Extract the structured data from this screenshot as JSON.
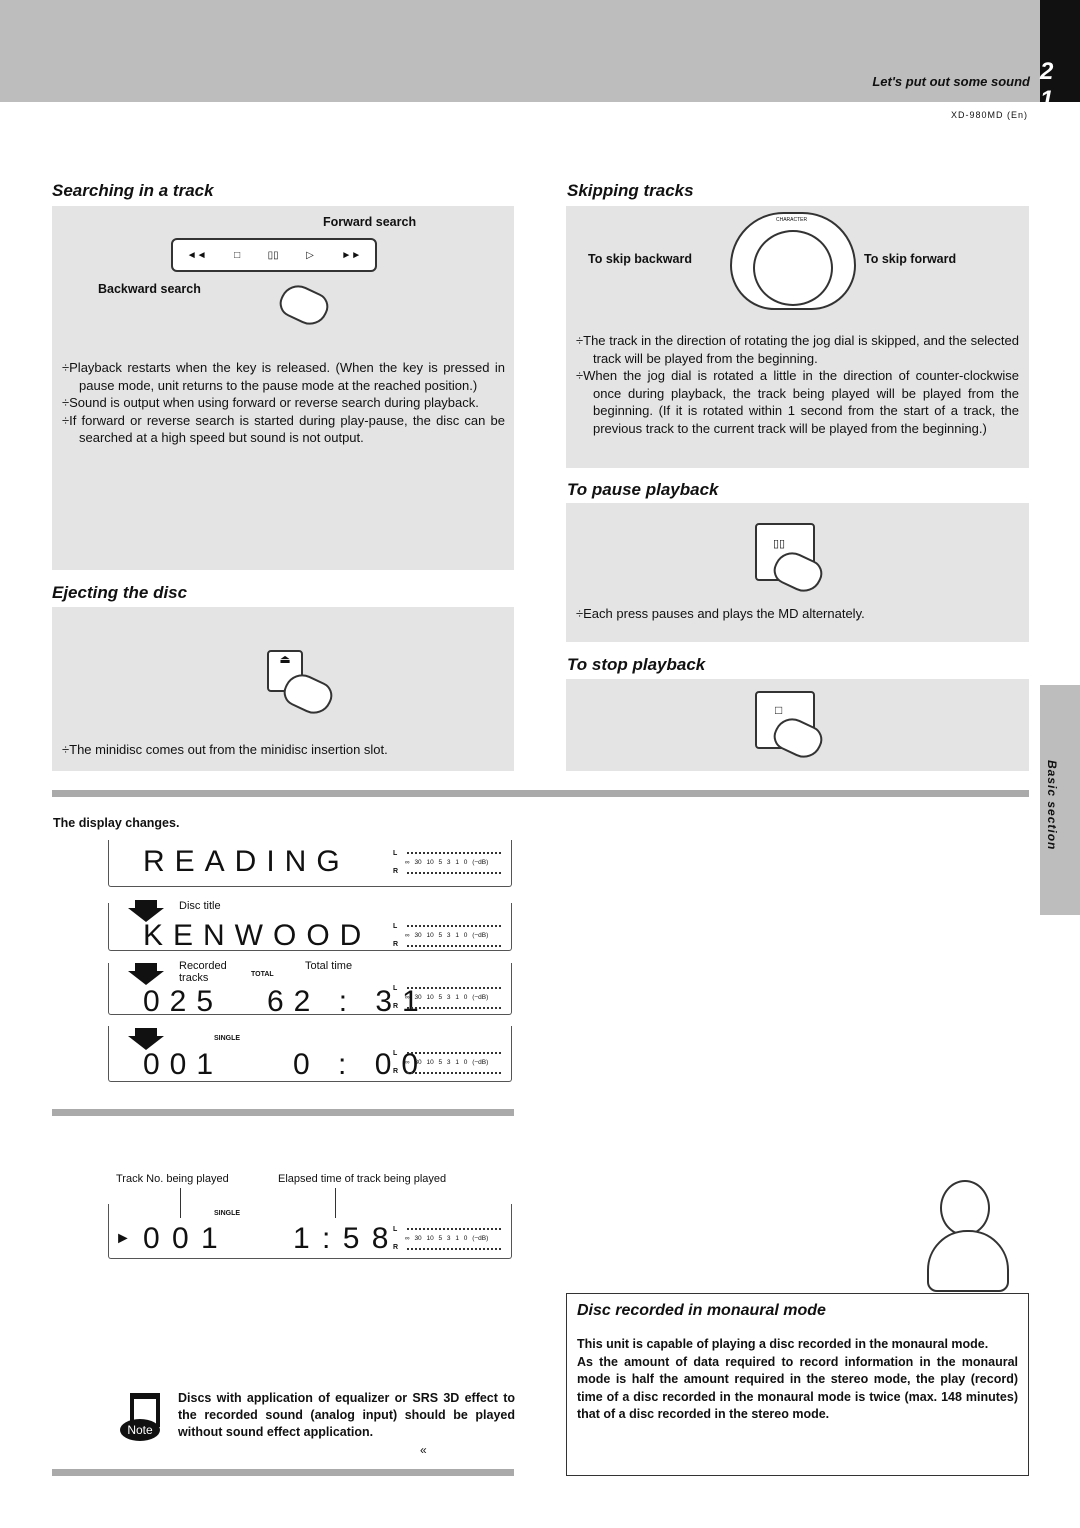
{
  "header": {
    "chapter": "Let's put out some sound",
    "page_number": "2 1",
    "model": "XD-980MD (En)"
  },
  "side_tab": "Basic section",
  "search": {
    "title": "Searching in a track",
    "forward_label": "Forward search",
    "backward_label": "Backward search",
    "bullets": [
      "Playback restarts when the key is released. (When the key is pressed in pause mode, unit returns to the pause mode at the reached position.)",
      "Sound is output when using forward or reverse search during playback.",
      "If forward or reverse search is started during play-pause, the disc can be searched at a high speed but sound is not output."
    ]
  },
  "skip": {
    "title": "Skipping tracks",
    "backward_label": "To skip backward",
    "forward_label": "To skip forward",
    "dial_label": "CHARACTER",
    "bullets": [
      "The track in the direction of rotating the jog dial is skipped, and the selected track will be played from the beginning.",
      "When the jog dial is rotated a little in the direction of counter-clockwise once during playback, the track being played will be played from the beginning. (If it is rotated within 1 second from the start of a track, the previous track to the current track will be played from the beginning.)"
    ]
  },
  "pause": {
    "title": "To pause playback",
    "bullets": [
      "Each press pauses and plays the MD alternately."
    ]
  },
  "eject": {
    "title": "Ejecting the disc",
    "bullets": [
      "The minidisc comes out from the minidisc insertion slot."
    ]
  },
  "stop": {
    "title": "To stop playback"
  },
  "display": {
    "heading": "The display changes.",
    "meter": {
      "l": "L",
      "r": "R",
      "scale": "∞ 30 10 5 3 1 0 (−dB)"
    },
    "screens": [
      {
        "text": "READING"
      },
      {
        "caption": "Disc title",
        "text": "KENWOOD"
      },
      {
        "caption": "Recorded tracks",
        "caption2": "Total time",
        "indicator": "TOTAL",
        "left": "025",
        "right": "62 : 31"
      },
      {
        "indicator": "SINGLE",
        "left": "001",
        "right": "0 : 00"
      }
    ],
    "playing": {
      "track_label": "Track No. being played",
      "time_label": "Elapsed time of track being played",
      "indicator": "SINGLE",
      "play_icon": "►",
      "left": "0 0 1",
      "right": "1 : 5 8"
    }
  },
  "note": {
    "icon_label": "Note",
    "text": "Discs with application of equalizer or SRS 3D effect to the recorded sound (analog input) should be played without sound effect application.",
    "mark": "«"
  },
  "mono": {
    "title": "Disc recorded in monaural mode",
    "p1": "This unit is capable of playing a disc recorded in the monaural mode.",
    "p2": "As the amount of data required to record information in the monaural mode is half the amount required in the stereo mode, the play (record) time of a disc recorded in the monaural mode is twice (max. 148 minutes) that of a disc recorded in the stereo mode."
  }
}
